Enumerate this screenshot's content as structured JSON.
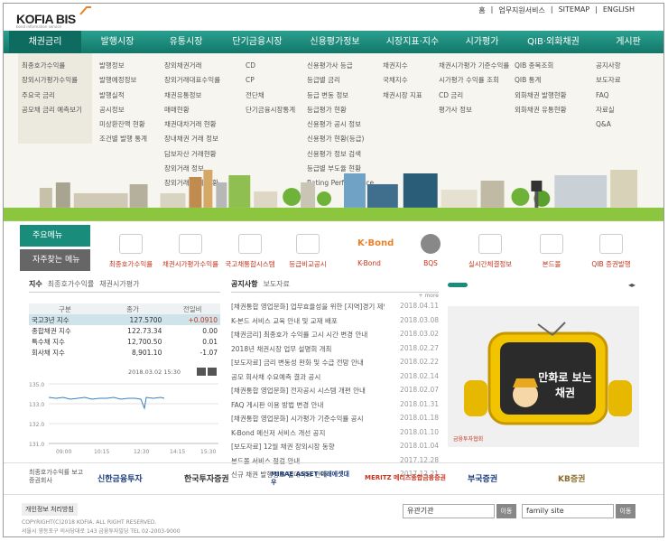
{
  "header": {
    "logo": "KOFIA BIS",
    "logo_sub": "bond information service",
    "links": [
      "홈",
      "업무지원서비스",
      "SITEMAP",
      "ENGLISH"
    ]
  },
  "nav": [
    "채권금리",
    "발행시장",
    "유통시장",
    "단기금융시장",
    "신용평가정보",
    "시장지표·지수",
    "시가평가",
    "QIB·외화채권",
    "게시판"
  ],
  "mega": [
    [
      "최종호가수익률",
      "장외시가평가수익률",
      "주요국 금리",
      "공모채 금리 예측보기"
    ],
    [
      "발행정보",
      "발행예정정보",
      "발행실적",
      "공시정보",
      "미상환잔액 현황",
      "조건별 발행 통계"
    ],
    [
      "장외채권거래",
      "장외거래대표수익률",
      "채권유통정보",
      "매매현황",
      "채권대차거래 현황",
      "장내채권 거래 정보",
      "담보자산 거래현황",
      "장외거래 정보",
      "장외거래 통계 현황"
    ],
    [
      "CD",
      "CP",
      "전단채",
      "단기금융시장통계"
    ],
    [
      "신용평가사 등급",
      "등급별 금리",
      "등급 변동 정보",
      "등급평가 현황",
      "신용평가 공시 정보",
      "신용평가 현황(등급)",
      "신용평가 정보 검색",
      "등급별 부도율 현황",
      "Rating Performance"
    ],
    [
      "채권지수",
      "국채지수",
      "채권시장 지표"
    ],
    [
      "채권시가평가 기준수익률",
      "시가평가 수익률 조회",
      "CD 금리",
      "평가사 정보"
    ],
    [
      "QIB 종목조회",
      "QIB 통계",
      "외화채권 발행현황",
      "외화채권 유통현황"
    ],
    [
      "공지사항",
      "보도자료",
      "FAQ",
      "자료실",
      "Q&A"
    ]
  ],
  "quick": {
    "main_menu": "주요메뉴",
    "fav_menu": "자주찾는 메뉴",
    "items": [
      "최종호가수익률",
      "채권시가평가수익률",
      "국고채통합시스템",
      "등급비교공시",
      "K-Bond",
      "BQS",
      "실시간체결정보",
      "본드몰",
      "QIB 증권발행"
    ]
  },
  "rates": {
    "tabs": [
      "지수",
      "최종호가수익률",
      "채권시가평가"
    ],
    "headers": [
      "구분",
      "종가",
      "전일비"
    ],
    "rows": [
      [
        "국고3년 지수",
        "127.5700",
        "+0.0910"
      ],
      [
        "종합채권 지수",
        "122.73.34",
        "0.00"
      ],
      [
        "특수채 지수",
        "12,700.50",
        "0.01"
      ],
      [
        "회사채 지수",
        "8,901.10",
        "-1.07"
      ]
    ],
    "date": "2018.03.02 15:30",
    "y_ticks": [
      "135.0",
      "133.0",
      "132.0",
      "131.0"
    ],
    "x_ticks": [
      "09:00",
      "10:15",
      "12:30",
      "14:15",
      "15:30"
    ]
  },
  "notice": {
    "tabs": [
      "공지사항",
      "보도자료"
    ],
    "more": "+ more",
    "items": [
      [
        "[채권통합 영업문화] 업무효율성을 위한 [지역]경기 제안",
        "2018.04.11"
      ],
      [
        "K-본드 서비스 교육 안내 및 교재 배포",
        "2018.03.08"
      ],
      [
        "[채권금리] 최종호가 수익률 고시 시간 변경 안내",
        "2018.03.02"
      ],
      [
        "2018년 채권시장 업무 설명회 개최",
        "2018.02.27"
      ],
      [
        "[보도자료] 금리 변동성 완화 및 수급 전망 안내",
        "2018.02.22"
      ],
      [
        "공모 회사채 수요예측 결과 공시",
        "2018.02.14"
      ],
      [
        "[채권통합 영업문화] 전자공시 시스템 개편 안내",
        "2018.02.07"
      ],
      [
        "FAQ 게시판 이용 방법 변경 안내",
        "2018.01.31"
      ],
      [
        "[채권통합 영업문화] 시가평가 기준수익률 공시",
        "2018.01.18"
      ],
      [
        "K-Bond 메신저 서비스 개선 공지",
        "2018.01.10"
      ],
      [
        "[보도자료] 12월 채권 장외시장 동향",
        "2018.01.04"
      ],
      [
        "본드몰 서비스 점검 안내",
        "2017.12.28"
      ],
      [
        "신규 채권 발행정보 업데이트 안내",
        "2017.12.21"
      ]
    ]
  },
  "promo": {
    "caption": "만화로 보는 채권",
    "brand": "금융투자협회"
  },
  "partners": {
    "label": "최종호가수익률 보고 증권회사",
    "names": [
      "신한금융투자",
      "한국투자증권",
      "MIRAE ASSET 미래에셋대우",
      "MERITZ 메리츠종합금융증권",
      "부국증권",
      "KB증권"
    ]
  },
  "footer": {
    "privacy": "개인정보 처리방침",
    "copy": "COPYRIGHT(C)2018 KOFIA. ALL RIGHT RESERVED.",
    "addr": "서울시 영등포구 의사당대로 143 금융투자빌딩 TEL 02-2003-9000",
    "sel1": "유관기관",
    "sel2": "family site",
    "go": "이동"
  },
  "colors": {
    "nav": "#1a8c7c",
    "accent": "#c8341c"
  }
}
